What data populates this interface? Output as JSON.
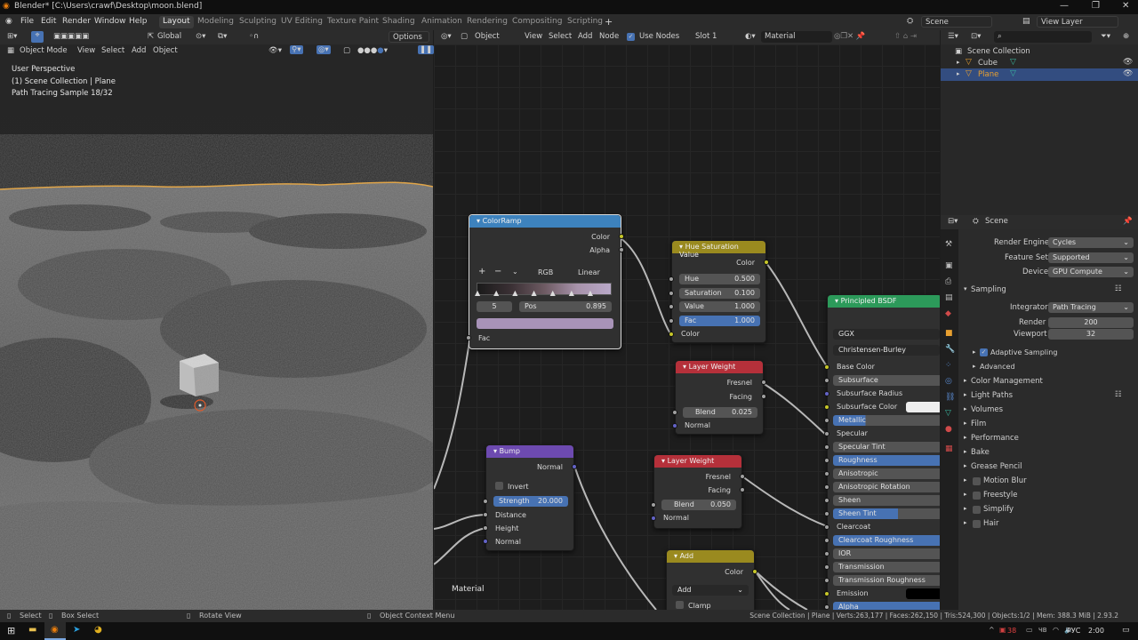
{
  "window": {
    "title": "Blender* [C:\\Users\\crawf\\Desktop\\moon.blend]"
  },
  "menu": [
    "File",
    "Edit",
    "Render",
    "Window",
    "Help"
  ],
  "workspaces": [
    "Layout",
    "Modeling",
    "Sculpting",
    "UV Editing",
    "Texture Paint",
    "Shading",
    "Animation",
    "Rendering",
    "Compositing",
    "Scripting"
  ],
  "topright": {
    "scene": "Scene",
    "view_layer": "View Layer"
  },
  "viewport": {
    "toolbar": {
      "transform": "Global",
      "options": "Options"
    },
    "header": {
      "mode": "Object Mode",
      "view": "View",
      "select": "Select",
      "add": "Add",
      "object": "Object"
    },
    "overlay_lines": [
      "User Perspective",
      "(1) Scene Collection | Plane",
      "Path Tracing Sample 18/32"
    ]
  },
  "node_editor": {
    "header": {
      "type": "Object",
      "view": "View",
      "select": "Select",
      "add": "Add",
      "node": "Node",
      "use_nodes": "Use Nodes",
      "slot": "Slot 1",
      "material": "Material"
    },
    "label": "Material",
    "colorramp": {
      "title": "ColorRamp",
      "out_color": "Color",
      "out_alpha": "Alpha",
      "mode": "RGB",
      "interp": "Linear",
      "index": "5",
      "pos_label": "Pos",
      "pos": "0.895",
      "in_fac": "Fac"
    },
    "huesat": {
      "title": "Hue Saturation Value",
      "out": "Color",
      "hue_l": "Hue",
      "hue": "0.500",
      "sat_l": "Saturation",
      "sat": "0.100",
      "val_l": "Value",
      "val": "1.000",
      "fac_l": "Fac",
      "fac": "1.000",
      "in_color": "Color"
    },
    "lw1": {
      "title": "Layer Weight",
      "fresnel": "Fresnel",
      "facing": "Facing",
      "blend_l": "Blend",
      "blend": "0.025",
      "normal": "Normal"
    },
    "lw2": {
      "title": "Layer Weight",
      "fresnel": "Fresnel",
      "facing": "Facing",
      "blend_l": "Blend",
      "blend": "0.050",
      "normal": "Normal"
    },
    "bump": {
      "title": "Bump",
      "out": "Normal",
      "invert": "Invert",
      "strength_l": "Strength",
      "strength": "20.000",
      "distance": "Distance",
      "height": "Height",
      "normal": "Normal"
    },
    "add": {
      "title": "Add",
      "out": "Color",
      "op": "Add",
      "clamp": "Clamp"
    },
    "bsdf": {
      "title": "Principled BSDF",
      "dist": "GGX",
      "sss": "Christensen-Burley",
      "inputs": [
        "Base Color",
        "Subsurface",
        "Subsurface Radius",
        "Subsurface Color",
        "Metallic",
        "Specular",
        "Specular Tint",
        "Roughness",
        "Anisotropic",
        "Anisotropic Rotation",
        "Sheen",
        "Sheen Tint",
        "Clearcoat",
        "Clearcoat Roughness",
        "IOR",
        "Transmission",
        "Transmission Roughness",
        "Emission",
        "Alpha"
      ]
    }
  },
  "outliner": {
    "collection": "Scene Collection",
    "items": [
      "Cube",
      "Plane"
    ]
  },
  "properties": {
    "scene": "Scene",
    "render_engine_l": "Render Engine",
    "render_engine": "Cycles",
    "feature_set_l": "Feature Set",
    "feature_set": "Supported",
    "device_l": "Device",
    "device": "GPU Compute",
    "sampling": "Sampling",
    "integrator_l": "Integrator",
    "integrator": "Path Tracing",
    "render_l": "Render",
    "render": "200",
    "viewport_l": "Viewport",
    "viewport": "32",
    "adaptive": "Adaptive Sampling",
    "advanced": "Advanced",
    "panels": [
      "Color Management",
      "Light Paths",
      "Volumes",
      "Film",
      "Performance",
      "Bake",
      "Grease Pencil"
    ],
    "checks": [
      "Motion Blur",
      "Freestyle",
      "Simplify",
      "Hair"
    ]
  },
  "status": {
    "select": "Select",
    "box": "Box Select",
    "rotate": "Rotate View",
    "ctx": "Object Context Menu",
    "stats": "Scene Collection | Plane | Verts:263,177 | Faces:262,150 | Tris:524,300 | Objects:1/2 | Mem: 388.3 MiB | 2.93.2"
  },
  "taskbar": {
    "lang": "РУС",
    "time": "2:00",
    "temp": "38",
    "weather": "ЧВ"
  }
}
